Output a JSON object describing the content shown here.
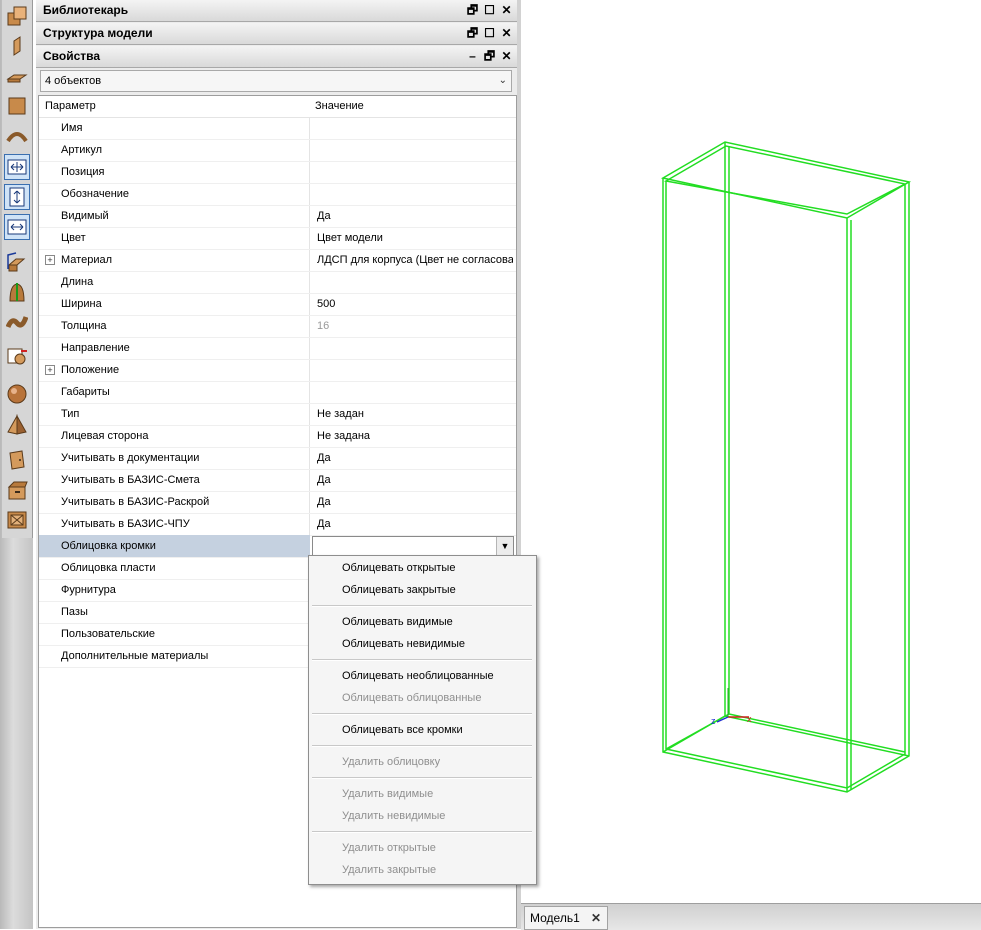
{
  "panels": {
    "library_title": "Библиотекарь",
    "model_tree_title": "Структура модели",
    "properties_title": "Свойства",
    "win_controls_restore": "🗗",
    "win_controls_max": "☐",
    "win_controls_close": "✕",
    "win_controls_min": "–"
  },
  "properties": {
    "object_selector": "4 объектов",
    "col_param": "Параметр",
    "col_value": "Значение",
    "rows": [
      {
        "k": "Имя",
        "v": ""
      },
      {
        "k": "Артикул",
        "v": ""
      },
      {
        "k": "Позиция",
        "v": ""
      },
      {
        "k": "Обозначение",
        "v": ""
      },
      {
        "k": "Видимый",
        "v": "Да"
      },
      {
        "k": "Цвет",
        "v": "Цвет модели"
      },
      {
        "k": "Материал",
        "v": "ЛДСП для корпуса (Цвет не согласова"
      },
      {
        "k": "Длина",
        "v": ""
      },
      {
        "k": "Ширина",
        "v": "500"
      },
      {
        "k": "Толщина",
        "v": "16"
      },
      {
        "k": "Направление",
        "v": ""
      },
      {
        "k": "Положение",
        "v": ""
      },
      {
        "k": "Габариты",
        "v": ""
      },
      {
        "k": "Тип",
        "v": "Не задан"
      },
      {
        "k": "Лицевая сторона",
        "v": "Не задана"
      },
      {
        "k": "Учитывать в документации",
        "v": "Да"
      },
      {
        "k": "Учитывать в БАЗИС-Смета",
        "v": "Да"
      },
      {
        "k": "Учитывать в БАЗИС-Раскрой",
        "v": "Да"
      },
      {
        "k": "Учитывать в БАЗИС-ЧПУ",
        "v": "Да"
      },
      {
        "k": "Облицовка кромки",
        "v": ""
      },
      {
        "k": "Облицовка пласти",
        "v": ""
      },
      {
        "k": "Фурнитура",
        "v": ""
      },
      {
        "k": "Пазы",
        "v": ""
      },
      {
        "k": "Пользовательские",
        "v": ""
      },
      {
        "k": "Дополнительные материалы",
        "v": ""
      }
    ],
    "expand_glyph": "+"
  },
  "dropdown_menu": {
    "items": [
      "Облицевать открытые",
      "Облицевать закрытые",
      "Облицевать видимые",
      "Облицевать невидимые",
      "Облицевать необлицованные",
      "Облицевать облицованные",
      "Облицевать все кромки",
      "Удалить облицовку",
      "Удалить видимые",
      "Удалить невидимые",
      "Удалить открытые",
      "Удалить закрытые"
    ]
  },
  "viewport": {
    "wireframe_color": "#22dd22",
    "axis_x_label": "x",
    "axis_z_label": "z"
  },
  "tabs": {
    "model_tab": "Модель1",
    "close": "✕"
  }
}
